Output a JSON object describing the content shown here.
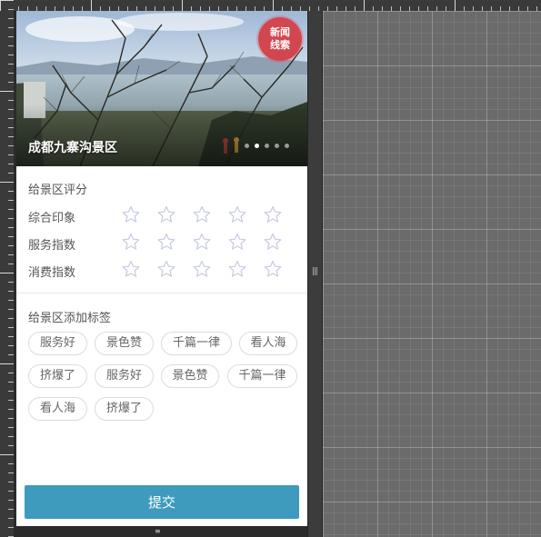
{
  "banner": {
    "title": "成都九寨沟景区",
    "badge_line1": "新闻",
    "badge_line2": "线索",
    "slide_count": 5,
    "active_slide": 2
  },
  "rating": {
    "section_title": "给景区评分",
    "rows": [
      {
        "label": "综合印象",
        "stars": 0,
        "max": 5
      },
      {
        "label": "服务指数",
        "stars": 0,
        "max": 5
      },
      {
        "label": "消费指数",
        "stars": 0,
        "max": 5
      }
    ]
  },
  "tags": {
    "section_title": "给景区添加标签",
    "items": [
      "服务好",
      "景色赞",
      "千篇一律",
      "看人海",
      "挤爆了",
      "服务好",
      "景色赞",
      "千篇一律",
      "看人海",
      "挤爆了"
    ]
  },
  "submit_label": "提交",
  "colors": {
    "accent": "#3e9bbd",
    "badge": "#d1464f",
    "star_outline": "#c5cbe0"
  }
}
